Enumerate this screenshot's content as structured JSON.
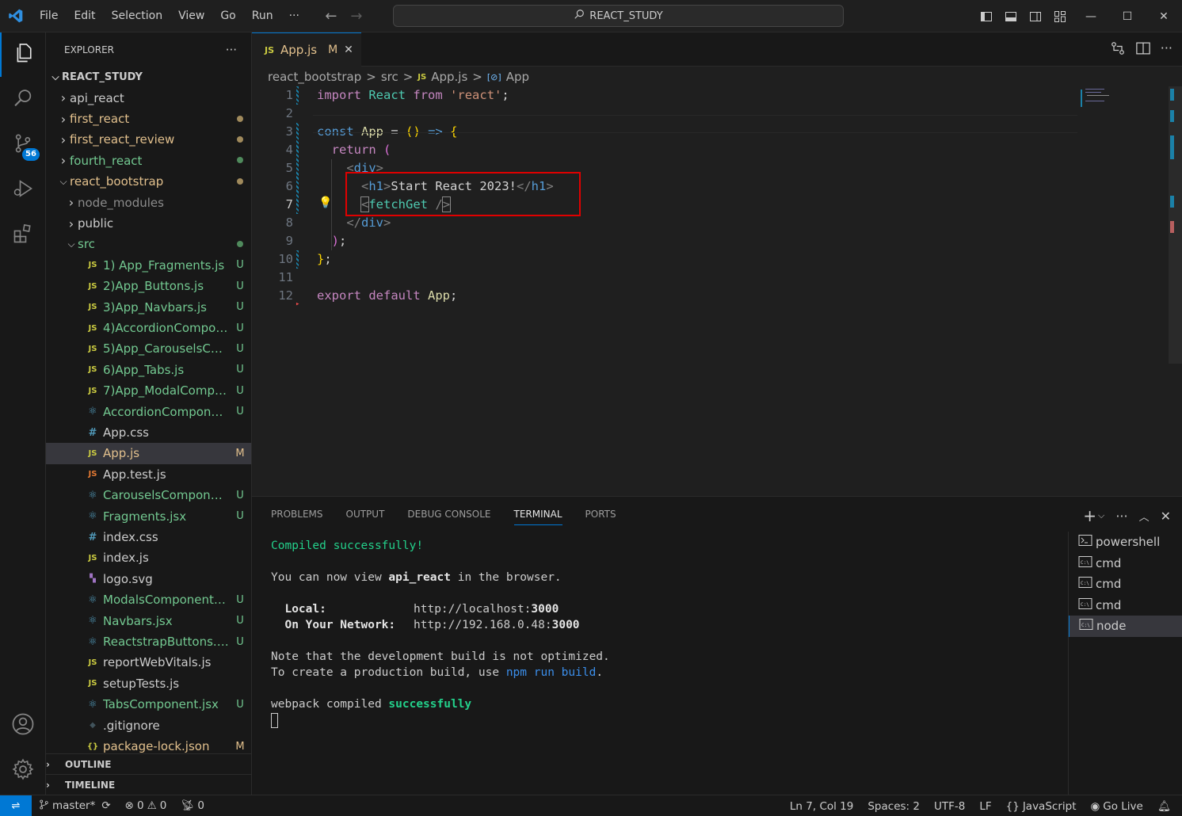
{
  "menu": [
    "File",
    "Edit",
    "Selection",
    "View",
    "Go",
    "Run",
    "···"
  ],
  "command_center": "REACT_STUDY",
  "colors": {
    "accent": "#0078d4",
    "modified": "#e2c08d",
    "untracked": "#73c991",
    "highlight": "#e00000"
  },
  "explorer": {
    "title": "EXPLORER",
    "more": "···",
    "root": "REACT_STUDY",
    "items": [
      {
        "label": "api_react",
        "type": "folder",
        "status": ""
      },
      {
        "label": "first_react",
        "type": "folder",
        "status": "dot"
      },
      {
        "label": "first_react_review",
        "type": "folder",
        "status": "dot"
      },
      {
        "label": "fourth_react",
        "type": "folder",
        "status": "dot-green"
      },
      {
        "label": "react_bootstrap",
        "type": "folder-open",
        "status": "dot"
      },
      {
        "label": "node_modules",
        "type": "folder",
        "status": ""
      },
      {
        "label": "public",
        "type": "folder",
        "status": ""
      },
      {
        "label": "src",
        "type": "folder-open",
        "status": "dot-green"
      },
      {
        "label": "1) App_Fragments.js",
        "type": "js",
        "status": "U"
      },
      {
        "label": "2)App_Buttons.js",
        "type": "js",
        "status": "U"
      },
      {
        "label": "3)App_Navbars.js",
        "type": "js",
        "status": "U"
      },
      {
        "label": "4)AccordionCompone...",
        "type": "js",
        "status": "U"
      },
      {
        "label": "5)App_CarouselsCom...",
        "type": "js",
        "status": "U"
      },
      {
        "label": "6)App_Tabs.js",
        "type": "js",
        "status": "U"
      },
      {
        "label": "7)App_ModalCompon...",
        "type": "js",
        "status": "U"
      },
      {
        "label": "AccordionComponent...",
        "type": "jsx",
        "status": "U"
      },
      {
        "label": "App.css",
        "type": "css",
        "status": ""
      },
      {
        "label": "App.js",
        "type": "js",
        "status": "M"
      },
      {
        "label": "App.test.js",
        "type": "test",
        "status": ""
      },
      {
        "label": "CarouselsComponent...",
        "type": "jsx",
        "status": "U"
      },
      {
        "label": "Fragments.jsx",
        "type": "jsx",
        "status": "U"
      },
      {
        "label": "index.css",
        "type": "css",
        "status": ""
      },
      {
        "label": "index.js",
        "type": "js",
        "status": ""
      },
      {
        "label": "logo.svg",
        "type": "svg",
        "status": ""
      },
      {
        "label": "ModalsComponent.jsx",
        "type": "jsx",
        "status": "U"
      },
      {
        "label": "Navbars.jsx",
        "type": "jsx",
        "status": "U"
      },
      {
        "label": "ReactstrapButtons.jsx",
        "type": "jsx",
        "status": "U"
      },
      {
        "label": "reportWebVitals.js",
        "type": "js",
        "status": ""
      },
      {
        "label": "setupTests.js",
        "type": "js",
        "status": ""
      },
      {
        "label": "TabsComponent.jsx",
        "type": "jsx",
        "status": "U"
      },
      {
        "label": ".gitignore",
        "type": "git",
        "status": ""
      },
      {
        "label": "package-lock.json",
        "type": "json",
        "status": "M"
      }
    ],
    "outline": "OUTLINE",
    "timeline": "TIMELINE"
  },
  "source_control_badge": "56",
  "tab": {
    "icon": "JS",
    "label": "App.js",
    "status": "M",
    "close": "✕"
  },
  "breadcrumb": {
    "parts": [
      "react_bootstrap",
      "src"
    ],
    "file": "App.js",
    "symbol": "App",
    "sep": ">"
  },
  "editor": {
    "line_numbers": [
      "1",
      "2",
      "3",
      "4",
      "5",
      "6",
      "7",
      "8",
      "9",
      "10",
      "11",
      "12"
    ],
    "current_line": "7"
  },
  "panel": {
    "tabs": [
      "PROBLEMS",
      "OUTPUT",
      "DEBUG CONSOLE",
      "TERMINAL",
      "PORTS"
    ],
    "terminals": [
      "powershell",
      "cmd",
      "cmd",
      "cmd",
      "node"
    ],
    "output": {
      "compiled": "Compiled successfully!",
      "view_prefix": "You can now view ",
      "app_name": "api_react",
      "view_suffix": " in the browser.",
      "local_label": "  Local:",
      "local_url_pre": "http://localhost:",
      "local_port": "3000",
      "network_label": "  On Your Network:",
      "network_url_pre": "http://192.168.0.48:",
      "network_port": "3000",
      "note1": "Note that the development build is not optimized.",
      "note2_pre": "To create a production build, use ",
      "note2_cmd": "npm run build",
      "note2_post": ".",
      "webpack_pre": "webpack compiled ",
      "webpack_status": "successfully"
    }
  },
  "statusbar": {
    "branch": "master*",
    "errors": "0",
    "warnings": "0",
    "ports": "0",
    "position": "Ln 7, Col 19",
    "spaces": "Spaces: 2",
    "encoding": "UTF-8",
    "eol": "LF",
    "language": "JavaScript",
    "golive": "Go Live"
  }
}
